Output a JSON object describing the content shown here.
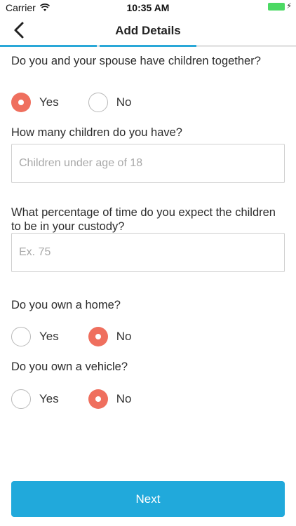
{
  "status_bar": {
    "carrier": "Carrier",
    "time": "10:35 AM",
    "battery_color": "#4cd964"
  },
  "nav": {
    "title": "Add Details",
    "back_icon": "chevron-left-icon",
    "progress_color": "#2aa8d8"
  },
  "questions": {
    "children_together": {
      "label": "Do you and your spouse have children together?",
      "options": [
        "Yes",
        "No"
      ],
      "selected": "Yes"
    },
    "children_count": {
      "label": "How many children do you have?",
      "placeholder": "Children under age of 18",
      "value": ""
    },
    "custody_percentage": {
      "label": "What percentage of time do you expect the children to be in your custody?",
      "placeholder": "Ex. 75",
      "value": ""
    },
    "own_home": {
      "label": "Do you own a home?",
      "options": [
        "Yes",
        "No"
      ],
      "selected": "No"
    },
    "own_vehicle": {
      "label": "Do you own a vehicle?",
      "options": [
        "Yes",
        "No"
      ],
      "selected": "No"
    }
  },
  "footer": {
    "next_label": "Next"
  },
  "colors": {
    "accent": "#21a9db",
    "radio_selected": "#ef6f5e"
  }
}
